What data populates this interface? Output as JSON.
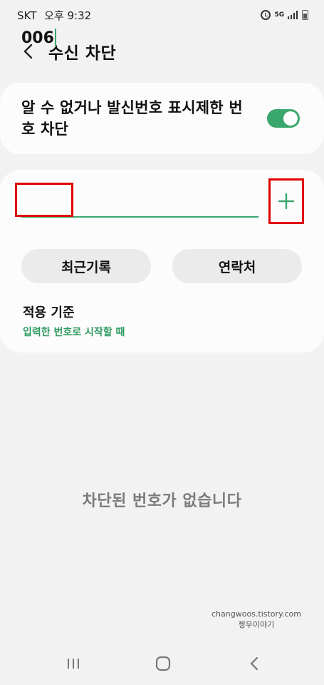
{
  "status_bar": {
    "carrier": "SKT",
    "time": "오후 9:32",
    "network_label": "5G",
    "icons": [
      "alarm-icon",
      "5g-icon",
      "signal-icon",
      "battery-icon"
    ]
  },
  "header": {
    "title": "수신 차단",
    "back_icon": "chevron-left-icon"
  },
  "unknown_block": {
    "label": "알 수 없거나 발신번호 표시제한 번호 차단",
    "enabled": true
  },
  "number_input": {
    "value": "006",
    "add_icon": "plus-icon"
  },
  "buttons": {
    "recent": "최근기록",
    "contacts": "연락처"
  },
  "criteria": {
    "title": "적용 기준",
    "value": "입력한 번호로 시작할 때"
  },
  "empty_message": "차단된 번호가 없습니다",
  "watermark": {
    "line1": "changwoos.tistory.com",
    "line2": "짱우이야기"
  },
  "nav": {
    "icons": [
      "recents-icon",
      "home-icon",
      "back-icon"
    ]
  },
  "colors": {
    "accent": "#3aa76d",
    "highlight": "#e00000",
    "background": "#f2f2f2",
    "card": "#fcfcfc"
  }
}
